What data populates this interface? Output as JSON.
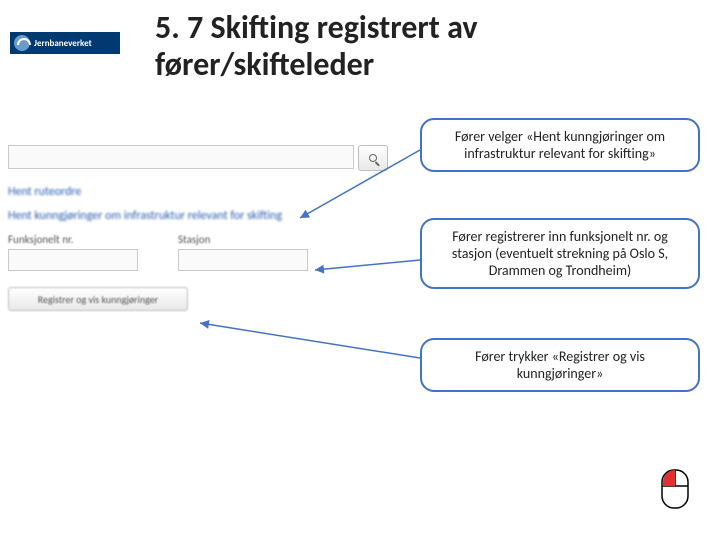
{
  "logo": {
    "brand": "Jernbaneverket"
  },
  "title": "5. 7 Skifting registrert av fører/skifteleder",
  "app": {
    "nav_blur_1": "Hent ruteordre",
    "nav_blur_2": "Hent kunngjøringer om infrastruktur relevant for skifting",
    "field1_label": "Funksjonelt nr.",
    "field2_label": "Stasjon",
    "button_label": "Registrer og vis kunngjøringer"
  },
  "callouts": {
    "c1": "Fører velger «Hent kunngjøringer om infrastruktur relevant for skifting»",
    "c2": "Fører registrerer inn funksjonelt nr. og stasjon (eventuelt strekning på Oslo S, Drammen og Trondheim)",
    "c3": "Fører trykker «Registrer og vis kunngjøringer»"
  }
}
